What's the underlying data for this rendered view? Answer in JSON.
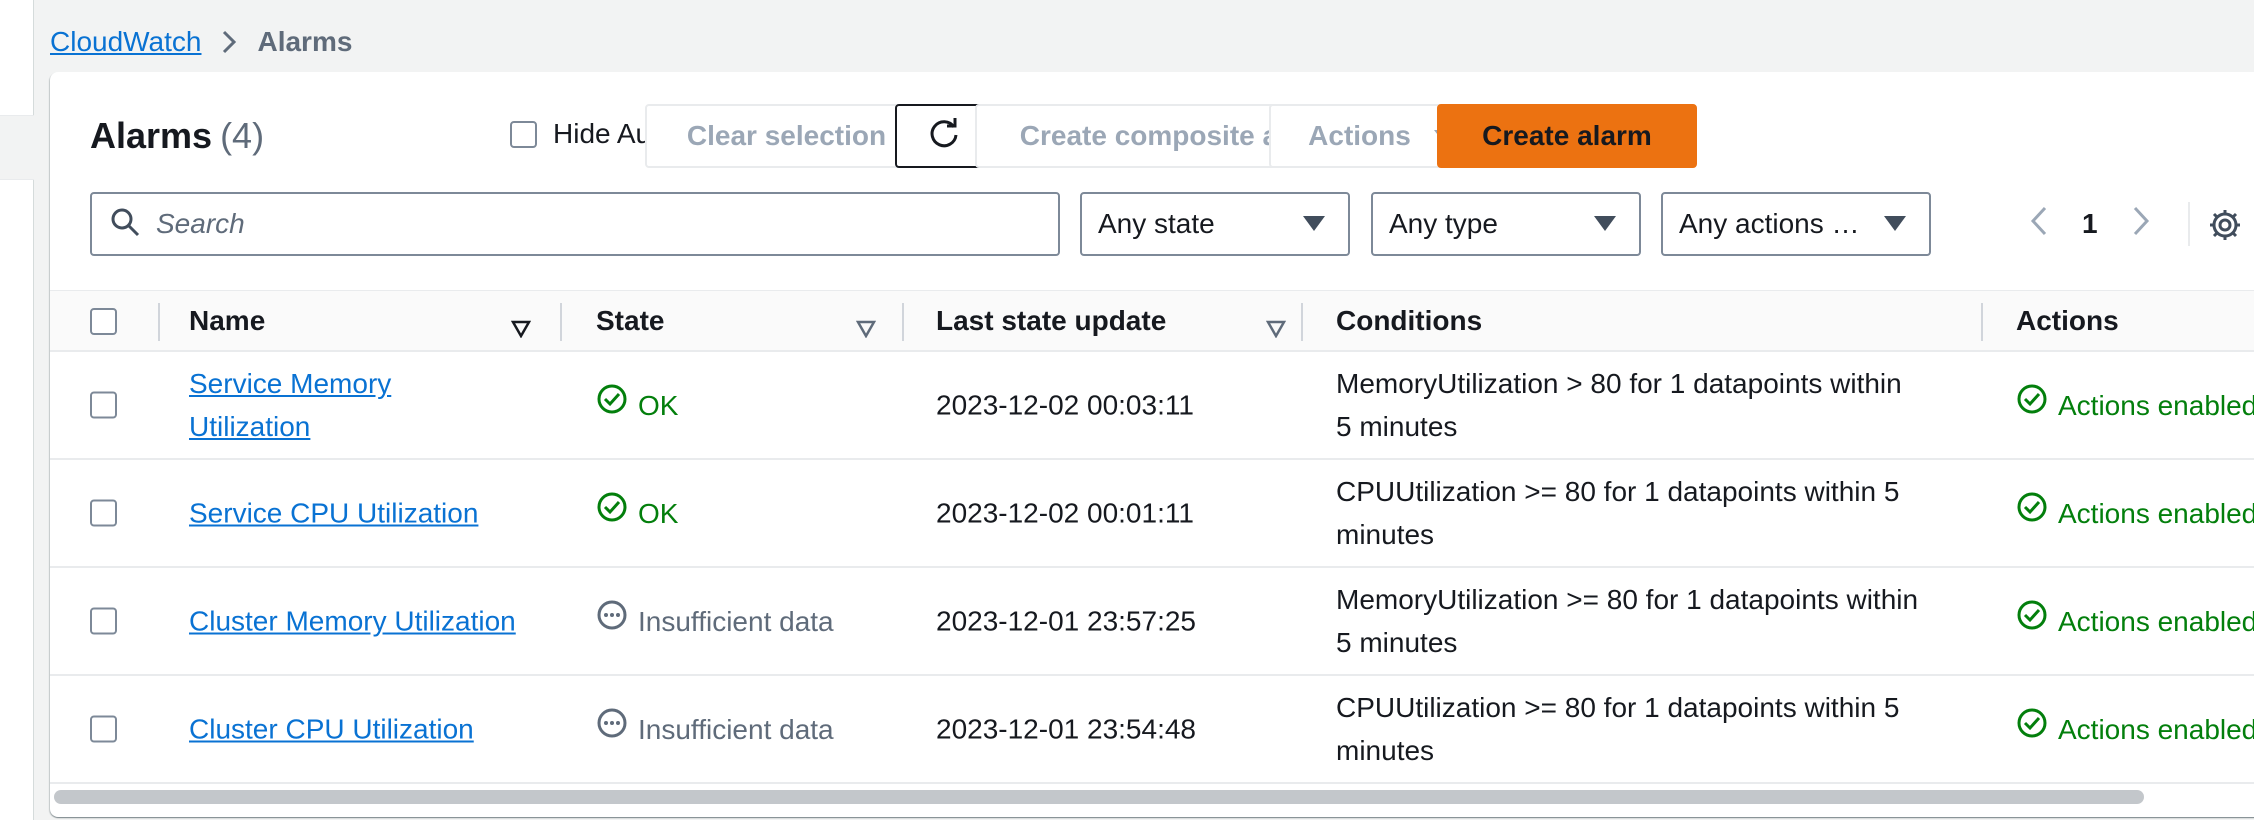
{
  "breadcrumb": {
    "root": "CloudWatch",
    "current": "Alarms"
  },
  "header": {
    "title": "Alarms",
    "count": "(4)",
    "hide_autoscaling_label": "Hide Auto Scaling alarms",
    "clear_selection": "Clear selection",
    "create_composite": "Create composite alarm",
    "actions": "Actions",
    "create_alarm": "Create alarm"
  },
  "filters": {
    "search_placeholder": "Search",
    "state": "Any state",
    "type": "Any type",
    "actions": "Any actions …",
    "page": "1"
  },
  "columns": {
    "name": "Name",
    "state": "State",
    "last_update": "Last state update",
    "conditions": "Conditions",
    "actions": "Actions"
  },
  "rows": [
    {
      "name_line1": "Service Memory",
      "name_line2": "Utilization",
      "state": "OK",
      "last_update": "2023-12-02 00:03:11",
      "cond_line1": "MemoryUtilization > 80 for 1 datapoints within",
      "cond_line2": "5 minutes",
      "actions": "Actions enabled"
    },
    {
      "name": "Service CPU Utilization",
      "state": "OK",
      "last_update": "2023-12-02 00:01:11",
      "cond_line1": "CPUUtilization >= 80 for 1 datapoints within 5",
      "cond_line2": "minutes",
      "actions": "Actions enabled"
    },
    {
      "name": "Cluster Memory Utilization",
      "state": "Insufficient data",
      "last_update": "2023-12-01 23:57:25",
      "cond_line1": "MemoryUtilization >= 80 for 1 datapoints within",
      "cond_line2": "5 minutes",
      "actions": "Actions enabled"
    },
    {
      "name": "Cluster CPU Utilization",
      "state": "Insufficient data",
      "last_update": "2023-12-01 23:54:48",
      "cond_line1": "CPUUtilization >= 80 for 1 datapoints within 5",
      "cond_line2": "minutes",
      "actions": "Actions enabled"
    }
  ],
  "colors": {
    "primary_button": "#ec7211",
    "link": "#0972d3",
    "ok_green": "#037f0c",
    "muted": "#5f6b7a"
  },
  "icons": {
    "breadcrumb_sep": "chevron-right-icon",
    "refresh": "refresh-icon",
    "search": "search-icon",
    "caret": "caret-down-icon",
    "prev": "chevron-left-icon",
    "next": "chevron-right-icon",
    "settings": "gear-icon",
    "ok": "check-circle-icon",
    "insufficient": "ellipsis-circle-icon"
  }
}
